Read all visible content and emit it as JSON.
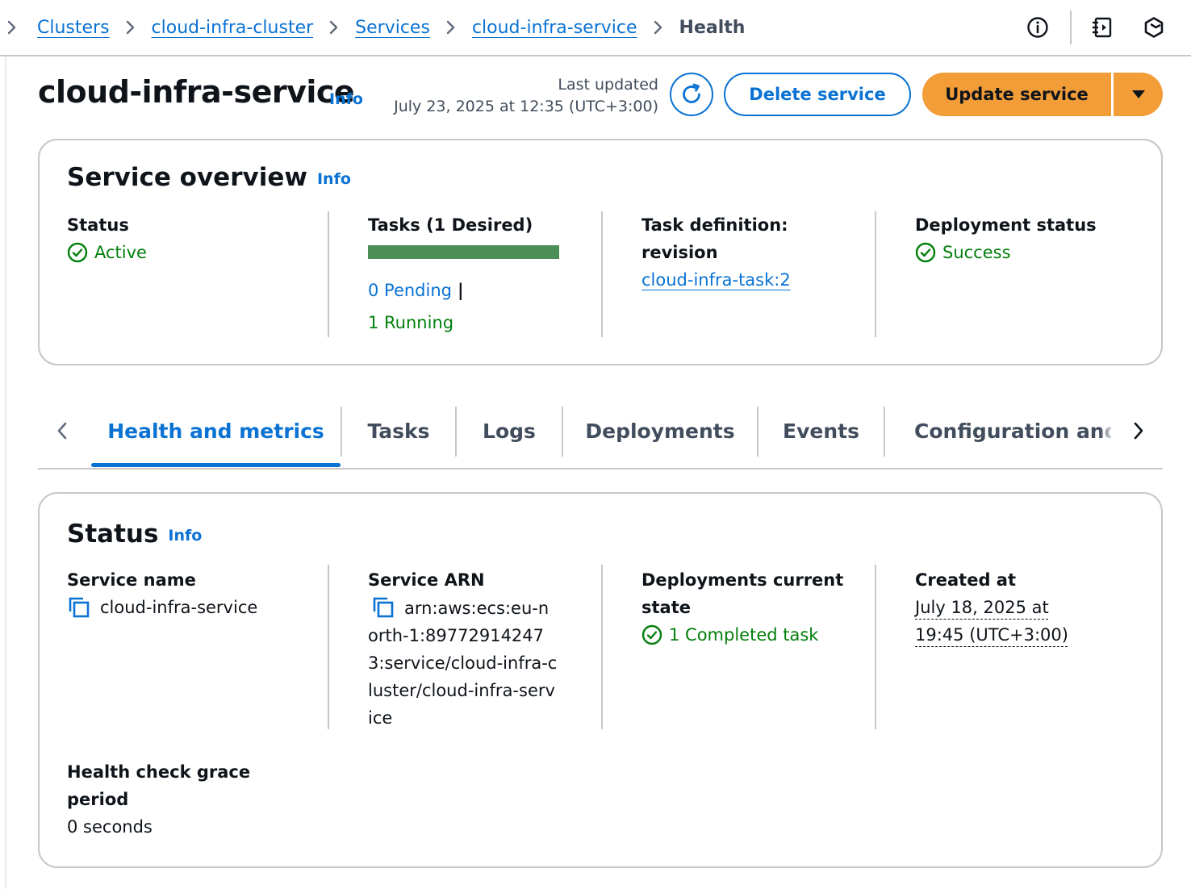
{
  "breadcrumb": {
    "items": [
      {
        "label": "Clusters",
        "link": true
      },
      {
        "label": "cloud-infra-cluster",
        "link": true
      },
      {
        "label": "Services",
        "link": true
      },
      {
        "label": "cloud-infra-service",
        "link": true
      },
      {
        "label": "Health",
        "link": false
      }
    ]
  },
  "top_icons": [
    "info-circle-icon",
    "notes-panel-icon",
    "hexagon-logo-icon"
  ],
  "header": {
    "title": "cloud-infra-service",
    "info": "Info",
    "last_updated_label": "Last updated",
    "last_updated_value": "July 23, 2025 at 12:35 (UTC+3:00)",
    "delete_label": "Delete service",
    "update_label": "Update service"
  },
  "overview": {
    "title": "Service overview",
    "info": "Info",
    "status_label": "Status",
    "status_value": "Active",
    "tasks_label": "Tasks (1 Desired)",
    "tasks_running_fraction": 1.0,
    "pending": "0 Pending",
    "pipe": "|",
    "running": "1 Running",
    "task_def_label_1": "Task definition:",
    "task_def_label_2": "revision",
    "task_def_value": "cloud-infra-task:2",
    "deployment_label": "Deployment status",
    "deployment_value": "Success"
  },
  "tabs": {
    "items": [
      {
        "label": "Health and metrics",
        "active": true
      },
      {
        "label": "Tasks",
        "active": false
      },
      {
        "label": "Logs",
        "active": false
      },
      {
        "label": "Deployments",
        "active": false
      },
      {
        "label": "Events",
        "active": false
      },
      {
        "label": "Configuration and networking",
        "active": false
      }
    ]
  },
  "status": {
    "title": "Status",
    "info": "Info",
    "service_name_label": "Service name",
    "service_name_value": "cloud-infra-service",
    "arn_label": "Service ARN",
    "arn_value": "arn:aws:ecs:eu-north-1:897729142473:service/cloud-infra-cluster/cloud-infra-service",
    "deploy_state_label_1": "Deployments current",
    "deploy_state_label_2": "state",
    "deploy_state_value": "1 Completed task",
    "created_label": "Created at",
    "created_line_1": "July 18, 2025 at",
    "created_line_2": "19:45 (UTC+3:00)",
    "grace_label_1": "Health check grace",
    "grace_label_2": "period",
    "grace_value": "0 seconds"
  },
  "colors": {
    "link_blue": "#0972d3",
    "primary_orange": "#f29d38",
    "success_green": "#037f0c",
    "progress_green": "#4b8f56",
    "border_gray": "#c6c6cd"
  }
}
